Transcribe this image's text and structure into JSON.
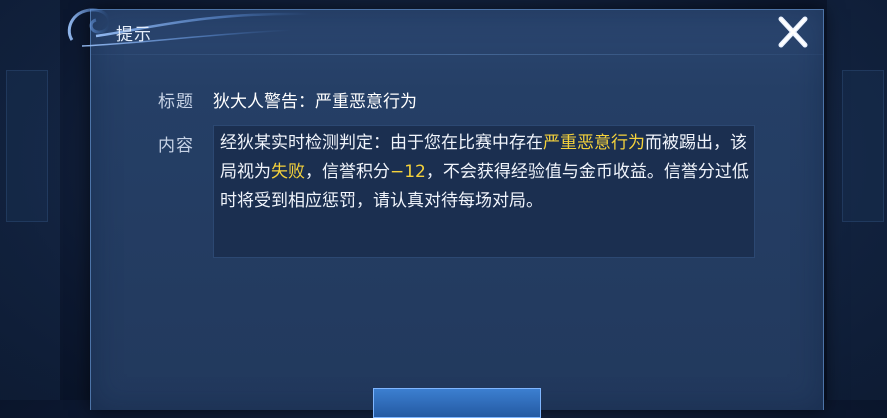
{
  "dialog": {
    "title": "提示",
    "close_icon": "close-icon",
    "title_label": "标题",
    "title_value": "狄大人警告：严重恶意行为",
    "content_label": "内容",
    "content": {
      "part1": "经狄某实时检测判定：由于您在比赛中存在",
      "highlight1": "严重恶意行为",
      "part2": "而被踢出，该局视为",
      "highlight2": "失败",
      "part3": "，信誉积分",
      "highlight3": "−12",
      "part4": "，不会获得经验值与金币收益。信誉分过低时将受到相应惩罚，请认真对待每场对局。"
    },
    "highlight_color": "#f5d23b"
  }
}
